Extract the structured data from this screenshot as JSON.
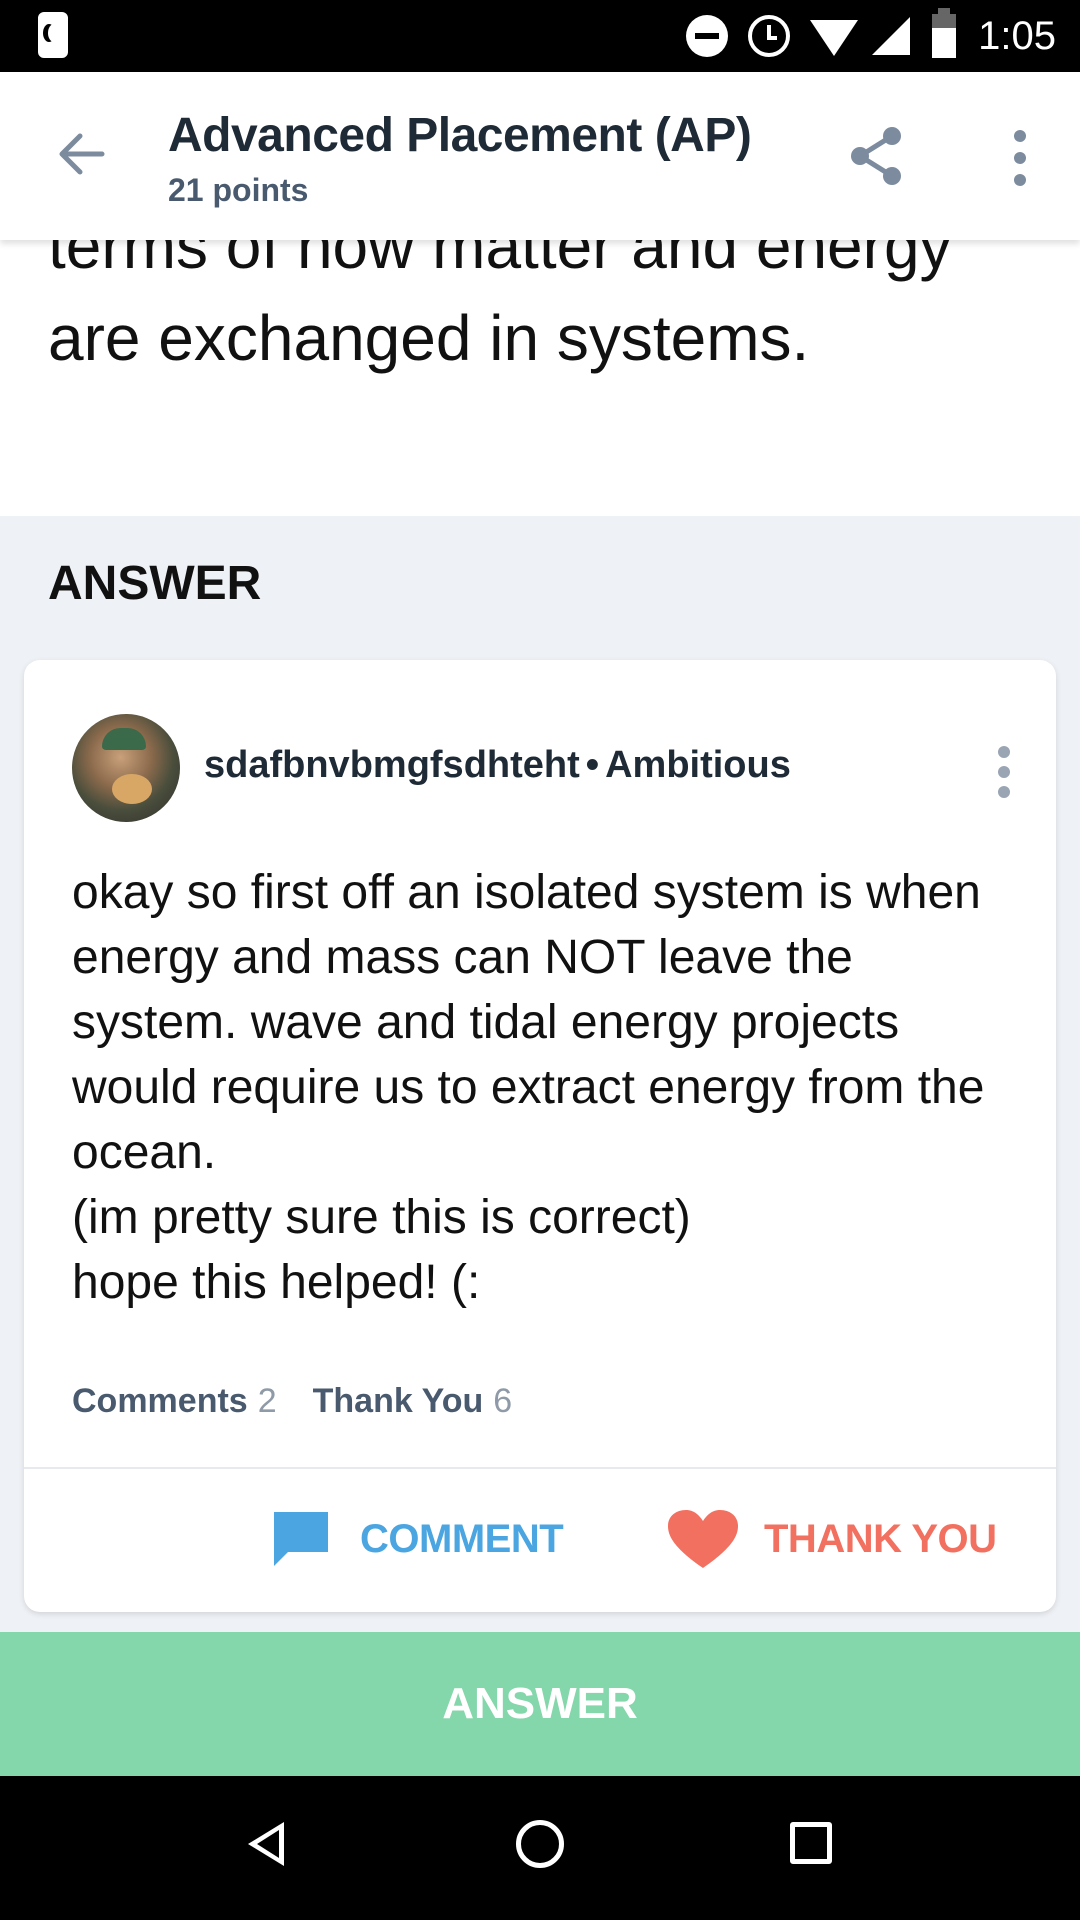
{
  "status_bar": {
    "time": "1:05",
    "icons": [
      "sim-icon",
      "do-not-disturb-icon",
      "alarm-icon",
      "wifi-icon",
      "signal-icon",
      "battery-icon"
    ]
  },
  "header": {
    "title": "Advanced Placement (AP)",
    "points": "21 points",
    "icons": [
      "back-arrow-icon",
      "share-icon",
      "more-vert-icon"
    ]
  },
  "question": {
    "text": "terms of how matter and energy are exchanged in systems."
  },
  "answer_section": {
    "label": "ANSWER"
  },
  "answer_card": {
    "username": "sdafbnvbmgfsdhteht",
    "separator": "•",
    "rank": "Ambitious",
    "body": "okay so first off an isolated system is when energy and mass can NOT leave the system. wave and tidal energy projects would require us to extract energy from the ocean.\n(im pretty sure this is correct)\nhope this helped! (:",
    "comments_label": "Comments",
    "comments_count": "2",
    "thanks_label": "Thank You",
    "thanks_count": "6",
    "comment_button": "COMMENT",
    "thank_button": "THANK YOU",
    "colors": {
      "comment": "#4aa5e0",
      "thank": "#f2705f"
    }
  },
  "cta": {
    "label": "ANSWER",
    "color": "#84d6ab"
  },
  "nav_bar": {
    "icons": [
      "nav-back-icon",
      "nav-home-icon",
      "nav-recents-icon"
    ]
  }
}
